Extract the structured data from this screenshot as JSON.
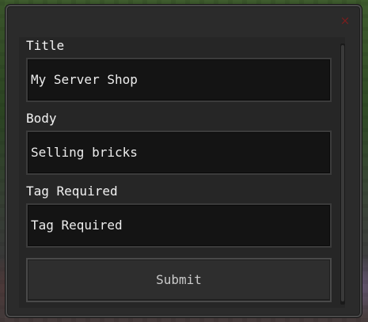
{
  "dialog": {
    "close_glyph": "×",
    "fields": [
      {
        "label": "Title",
        "value": "My Server Shop"
      },
      {
        "label": "Body",
        "value": "Selling bricks"
      },
      {
        "label": "Tag Required",
        "value": "Tag Required"
      }
    ],
    "submit_label": "Submit"
  },
  "colors": {
    "panel": "#2b2b2b",
    "field_bg": "#141414",
    "close": "#7a1e1e",
    "text": "#f2f2f2"
  },
  "icons": {
    "close": "close-icon"
  }
}
